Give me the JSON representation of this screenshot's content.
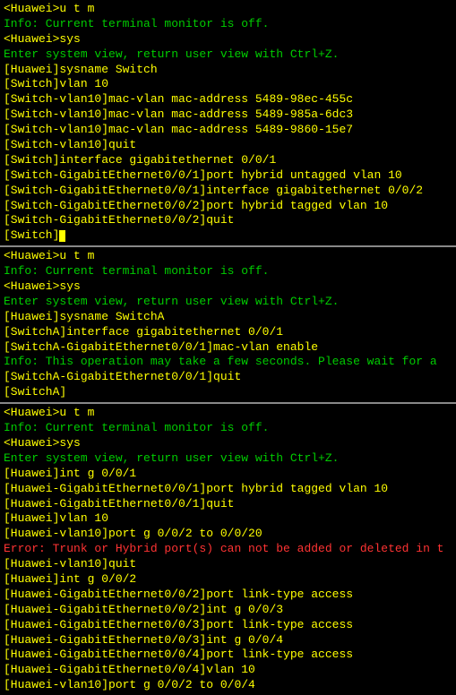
{
  "blocks": [
    {
      "lines": [
        {
          "type": "prompt",
          "text": "<Huawei>u t m"
        },
        {
          "type": "info",
          "text": "Info: Current terminal monitor is off."
        },
        {
          "type": "prompt",
          "text": "<Huawei>sys"
        },
        {
          "type": "info",
          "text": "Enter system view, return user view with Ctrl+Z."
        },
        {
          "type": "prompt",
          "text": "[Huawei]sysname Switch"
        },
        {
          "type": "prompt",
          "text": "[Switch]vlan 10"
        },
        {
          "type": "prompt",
          "text": "[Switch-vlan10]mac-vlan mac-address 5489-98ec-455c"
        },
        {
          "type": "prompt",
          "text": "[Switch-vlan10]mac-vlan mac-address 5489-985a-6dc3"
        },
        {
          "type": "prompt",
          "text": "[Switch-vlan10]mac-vlan mac-address 5489-9860-15e7"
        },
        {
          "type": "prompt",
          "text": "[Switch-vlan10]quit"
        },
        {
          "type": "prompt",
          "text": "[Switch]interface gigabitethernet 0/0/1"
        },
        {
          "type": "prompt",
          "text": "[Switch-GigabitEthernet0/0/1]port hybrid untagged vlan 10"
        },
        {
          "type": "prompt",
          "text": "[Switch-GigabitEthernet0/0/1]interface gigabitethernet 0/0/2"
        },
        {
          "type": "prompt",
          "text": "[Switch-GigabitEthernet0/0/2]port hybrid tagged vlan 10"
        },
        {
          "type": "prompt",
          "text": "[Switch-GigabitEthernet0/0/2]quit"
        },
        {
          "type": "prompt-cursor",
          "text": "[Switch]"
        }
      ]
    },
    {
      "lines": [
        {
          "type": "prompt",
          "text": "<Huawei>u t m"
        },
        {
          "type": "info",
          "text": "Info: Current terminal monitor is off."
        },
        {
          "type": "prompt",
          "text": "<Huawei>sys"
        },
        {
          "type": "info",
          "text": "Enter system view, return user view with Ctrl+Z."
        },
        {
          "type": "prompt",
          "text": "[Huawei]sysname SwitchA"
        },
        {
          "type": "prompt",
          "text": "[SwitchA]interface gigabitethernet 0/0/1"
        },
        {
          "type": "prompt",
          "text": "[SwitchA-GigabitEthernet0/0/1]mac-vlan enable"
        },
        {
          "type": "info",
          "text": "Info: This operation may take a few seconds. Please wait for a "
        },
        {
          "type": "prompt",
          "text": "[SwitchA-GigabitEthernet0/0/1]quit"
        },
        {
          "type": "prompt",
          "text": "[SwitchA]"
        }
      ]
    },
    {
      "lines": [
        {
          "type": "prompt",
          "text": "<Huawei>u t m"
        },
        {
          "type": "info",
          "text": "Info: Current terminal monitor is off."
        },
        {
          "type": "prompt",
          "text": "<Huawei>sys"
        },
        {
          "type": "info",
          "text": "Enter system view, return user view with Ctrl+Z."
        },
        {
          "type": "prompt",
          "text": "[Huawei]int g 0/0/1"
        },
        {
          "type": "prompt",
          "text": "[Huawei-GigabitEthernet0/0/1]port hybrid tagged vlan 10"
        },
        {
          "type": "prompt",
          "text": "[Huawei-GigabitEthernet0/0/1]quit"
        },
        {
          "type": "prompt",
          "text": "[Huawei]vlan 10"
        },
        {
          "type": "prompt",
          "text": "[Huawei-vlan10]port g 0/0/2 to 0/0/20"
        },
        {
          "type": "error",
          "text": "Error: Trunk or Hybrid port(s) can not be added or deleted in t"
        },
        {
          "type": "prompt",
          "text": "[Huawei-vlan10]quit"
        },
        {
          "type": "prompt",
          "text": "[Huawei]int g 0/0/2"
        },
        {
          "type": "prompt",
          "text": "[Huawei-GigabitEthernet0/0/2]port link-type access"
        },
        {
          "type": "prompt",
          "text": "[Huawei-GigabitEthernet0/0/2]int g 0/0/3"
        },
        {
          "type": "prompt",
          "text": "[Huawei-GigabitEthernet0/0/3]port link-type access"
        },
        {
          "type": "prompt",
          "text": "[Huawei-GigabitEthernet0/0/3]int g 0/0/4"
        },
        {
          "type": "prompt",
          "text": "[Huawei-GigabitEthernet0/0/4]port link-type access"
        },
        {
          "type": "prompt",
          "text": "[Huawei-GigabitEthernet0/0/4]vlan 10"
        },
        {
          "type": "prompt",
          "text": "[Huawei-vlan10]port g 0/0/2 to 0/0/4"
        }
      ]
    }
  ]
}
